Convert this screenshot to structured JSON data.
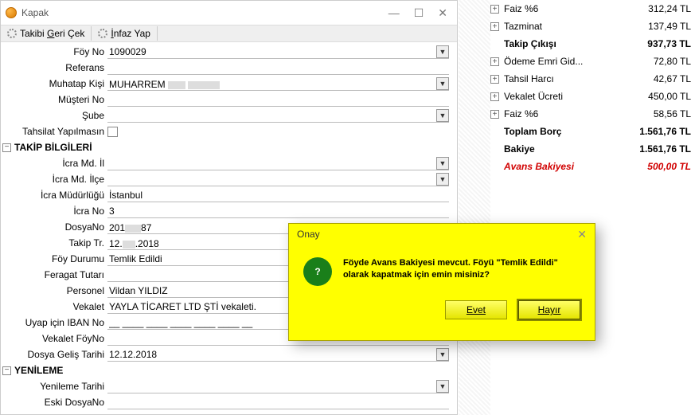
{
  "window": {
    "title": "Kapak"
  },
  "toolbar": {
    "btn1_pre": "Takibi ",
    "btn1_key": "G",
    "btn1_post": "eri Çek",
    "btn2_pre": "",
    "btn2_key": "İ",
    "btn2_post": "nfaz Yap"
  },
  "labels": {
    "foyno": "Föy No",
    "referans": "Referans",
    "muhatap": "Muhatap Kişi",
    "musteri": "Müşteri No",
    "sube": "Şube",
    "tahsilat": "Tahsilat Yapılmasın",
    "section_takip": "TAKİP BİLGİLERİ",
    "icramd_il": "İcra Md. İl",
    "icramd_ilce": "İcra Md. İlçe",
    "icramud": "İcra Müdürlüğü",
    "icrano": "İcra No",
    "dosyano": "DosyaNo",
    "takiptr": "Takip Tr.",
    "foydurumu": "Föy Durumu",
    "feragat": "Feragat Tutarı",
    "personel": "Personel",
    "vekalet": "Vekalet",
    "uyapiban": "Uyap için IBAN No",
    "vekaletfoyno": "Vekalet FöyNo",
    "dosyagelis": "Dosya Geliş Tarihi",
    "section_yenileme": "YENİLEME",
    "yenilemetarihi": "Yenileme Tarihi",
    "eskidosyano": "Eski DosyaNo"
  },
  "values": {
    "foyno": "1090029",
    "muhatap": "MUHARREM ",
    "icramud": "İstanbul",
    "icrano": "3",
    "dosyano_pre": "201",
    "dosyano_post": "87",
    "takiptr_pre": "12.",
    "takiptr_post": ".2018",
    "foydurumu": "Temlik Edildi",
    "personel": "Vildan YILDIZ",
    "vekalet": "YAYLA TİCARET LTD ŞTİ vekaleti.",
    "uyapiban": "__ ____ ____ ____ ____ ____ __",
    "dosyagelis": "12.12.2018"
  },
  "summary": [
    {
      "exp": "+",
      "name": "Faiz  %6",
      "amt": "312,24 TL",
      "bold": false
    },
    {
      "exp": "+",
      "name": "Tazminat",
      "amt": "137,49 TL",
      "bold": false
    },
    {
      "exp": "",
      "name": "Takip Çıkışı",
      "amt": "937,73 TL",
      "bold": true
    },
    {
      "exp": "+",
      "name": "Ödeme Emri Gid...",
      "amt": "72,80 TL",
      "bold": false
    },
    {
      "exp": "+",
      "name": "Tahsil Harcı",
      "amt": "42,67 TL",
      "bold": false
    },
    {
      "exp": "+",
      "name": "Vekalet Ücreti",
      "amt": "450,00 TL",
      "bold": false
    },
    {
      "exp": "+",
      "name": "Faiz  %6",
      "amt": "58,56 TL",
      "bold": false
    },
    {
      "exp": "",
      "name": "Toplam Borç",
      "amt": "1.561,76 TL",
      "bold": true
    },
    {
      "exp": "",
      "name": "Bakiye",
      "amt": "1.561,76 TL",
      "bold": true
    },
    {
      "exp": "",
      "name": "Avans Bakiyesi",
      "amt": "500,00 TL",
      "red": true
    }
  ],
  "dialog": {
    "title": "Onay",
    "icon_text": "?",
    "message": "Föyde Avans Bakiyesi mevcut. Föyü \"Temlik Edildi\" olarak kapatmak için emin misiniz?",
    "yes_key": "E",
    "yes_rest": "vet",
    "no_key": "H",
    "no_rest": "ayır"
  }
}
